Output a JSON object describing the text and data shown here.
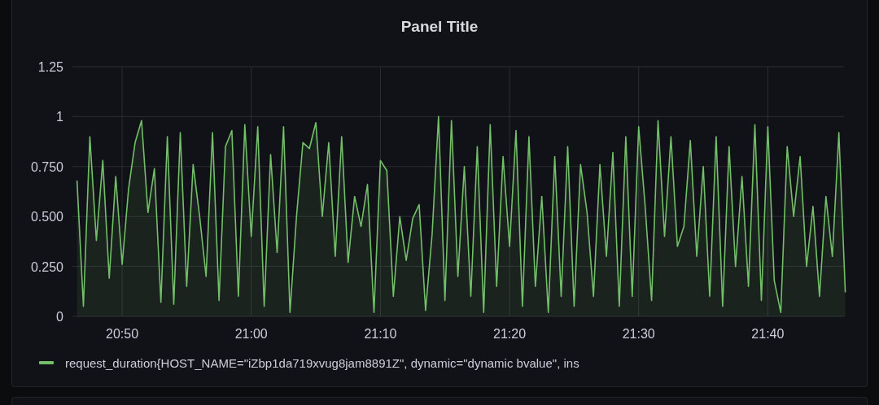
{
  "panel": {
    "title": "Panel Title",
    "chart_data": {
      "type": "area",
      "grid": true,
      "ylim": [
        0,
        1.25
      ],
      "yticks": [
        {
          "value": 0,
          "label": "0"
        },
        {
          "value": 0.25,
          "label": "0.250"
        },
        {
          "value": 0.5,
          "label": "0.500"
        },
        {
          "value": 0.75,
          "label": "0.750"
        },
        {
          "value": 1,
          "label": "1"
        },
        {
          "value": 1.25,
          "label": "1.25"
        }
      ],
      "categories": [
        null,
        null,
        null,
        null,
        null,
        null,
        null,
        "20:50",
        null,
        null,
        null,
        null,
        null,
        null,
        null,
        null,
        null,
        null,
        null,
        null,
        null,
        null,
        null,
        null,
        null,
        null,
        null,
        "21:00",
        null,
        null,
        null,
        null,
        null,
        null,
        null,
        null,
        null,
        null,
        null,
        null,
        null,
        null,
        null,
        null,
        null,
        null,
        null,
        "21:10",
        null,
        null,
        null,
        null,
        null,
        null,
        null,
        null,
        null,
        null,
        null,
        null,
        null,
        null,
        null,
        null,
        null,
        null,
        null,
        "21:20",
        null,
        null,
        null,
        null,
        null,
        null,
        null,
        null,
        null,
        null,
        null,
        null,
        null,
        null,
        null,
        null,
        null,
        null,
        null,
        "21:30",
        null,
        null,
        null,
        null,
        null,
        null,
        null,
        null,
        null,
        null,
        null,
        null,
        null,
        null,
        null,
        null,
        null,
        null,
        null,
        "21:40",
        null,
        null,
        null,
        null,
        null,
        null,
        null,
        null,
        null,
        null,
        null,
        null
      ],
      "series": [
        {
          "name": "request_duration{HOST_NAME=\"iZbp1da719xvug8jam8891Z\", dynamic=\"dynamic bvalue\", ins",
          "color": "#73bf69",
          "values": [
            0.68,
            0.05,
            0.9,
            0.38,
            0.78,
            0.19,
            0.7,
            0.26,
            0.64,
            0.87,
            0.98,
            0.52,
            0.74,
            0.07,
            0.9,
            0.06,
            0.92,
            0.15,
            0.76,
            0.5,
            0.2,
            0.92,
            0.08,
            0.85,
            0.93,
            0.1,
            0.96,
            0.4,
            0.95,
            0.05,
            0.81,
            0.32,
            0.95,
            0.02,
            0.5,
            0.87,
            0.84,
            0.97,
            0.5,
            0.87,
            0.3,
            0.9,
            0.27,
            0.6,
            0.45,
            0.66,
            0.02,
            0.78,
            0.73,
            0.1,
            0.5,
            0.28,
            0.49,
            0.56,
            0.03,
            0.41,
            1.0,
            0.08,
            0.98,
            0.2,
            0.75,
            0.1,
            0.85,
            0.02,
            0.96,
            0.15,
            0.8,
            0.35,
            0.93,
            0.05,
            0.9,
            0.15,
            0.6,
            0.02,
            0.8,
            0.1,
            0.85,
            0.05,
            0.76,
            0.52,
            0.1,
            0.76,
            0.3,
            0.82,
            0.05,
            0.9,
            0.1,
            0.95,
            0.55,
            0.08,
            0.98,
            0.4,
            0.9,
            0.35,
            0.45,
            0.88,
            0.3,
            0.75,
            0.1,
            0.9,
            0.05,
            0.85,
            0.25,
            0.7,
            0.15,
            0.96,
            0.08,
            0.95,
            0.18,
            0.02,
            0.85,
            0.5,
            0.8,
            0.25,
            0.55,
            0.1,
            0.6,
            0.3,
            0.92,
            0.12
          ]
        }
      ]
    }
  }
}
